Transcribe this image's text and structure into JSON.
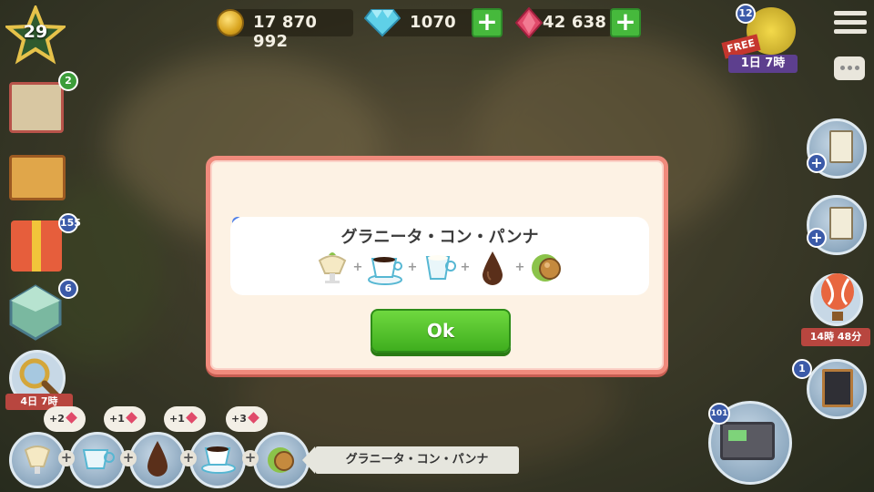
{
  "hud": {
    "level": "29",
    "coins": "17 870 992",
    "diamonds": "1070",
    "gems": "42 638",
    "free_label": "FREE",
    "free_badge": "12",
    "free_timer": "1日 7時"
  },
  "left_badges": [
    "2",
    "155",
    "6"
  ],
  "left_timer": "4日 7時",
  "right": {
    "balloon_timer": "14時 48分",
    "menu_badge": "1",
    "register_badge": "101"
  },
  "dialog": {
    "recipe_name": "グラニータ・コン・パンナ",
    "ingredients": [
      "granita-icon",
      "coffee-cup-icon",
      "milk-cup-icon",
      "chocolate-drop-icon",
      "hazelnut-icon"
    ],
    "ok_label": "Ok"
  },
  "bottom_bar": {
    "bubbles": [
      "+2",
      "+1",
      "+1",
      "+3"
    ],
    "recipe_label": "グラニータ・コン・パンナ"
  },
  "colors": {
    "dialog_border": "#f08a7c",
    "ok_green": "#4cc22a",
    "plus_green": "#46b93c",
    "gem_pink": "#e04a6a",
    "diamond_cyan": "#5fd0e8"
  }
}
